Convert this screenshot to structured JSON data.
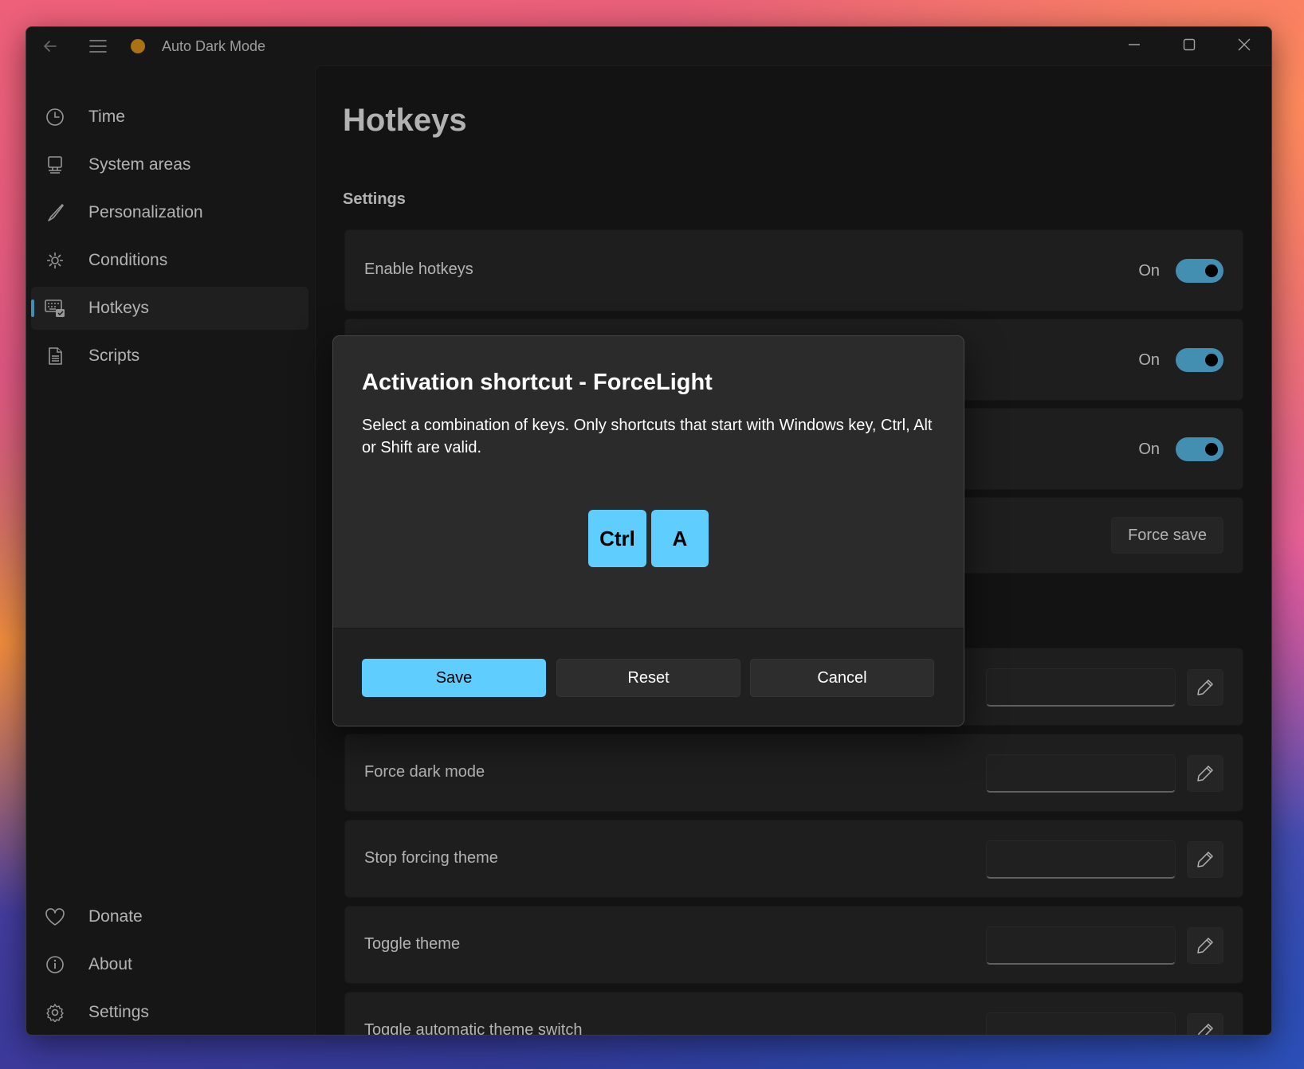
{
  "app": {
    "title": "Auto Dark Mode"
  },
  "nav": {
    "items": [
      {
        "label": "Time",
        "icon": "clock-icon"
      },
      {
        "label": "System areas",
        "icon": "monitor-icon"
      },
      {
        "label": "Personalization",
        "icon": "brush-icon"
      },
      {
        "label": "Conditions",
        "icon": "conditions-icon"
      },
      {
        "label": "Hotkeys",
        "icon": "keyboard-icon",
        "selected": true
      },
      {
        "label": "Scripts",
        "icon": "document-icon"
      }
    ],
    "footer_items": [
      {
        "label": "Donate",
        "icon": "heart-icon"
      },
      {
        "label": "About",
        "icon": "info-icon"
      },
      {
        "label": "Settings",
        "icon": "gear-icon"
      }
    ]
  },
  "page": {
    "title": "Hotkeys",
    "settings_header": "Settings",
    "enable_hotkeys": "Enable hotkeys",
    "on_label": "On",
    "force_save": "Force save",
    "hotkey_rows": [
      "Force dark mode",
      "Stop forcing theme",
      "Toggle theme",
      "Toggle automatic theme switch"
    ]
  },
  "dialog": {
    "title": "Activation shortcut - ForceLight",
    "message": "Select a combination of keys. Only shortcuts that start with Windows key, Ctrl, Alt or Shift are valid.",
    "keys": [
      "Ctrl",
      "A"
    ],
    "save": "Save",
    "reset": "Reset",
    "cancel": "Cancel"
  },
  "colors": {
    "accent": "#60cdff",
    "window_bg": "#202020",
    "card_bg": "#2b2b2b"
  }
}
